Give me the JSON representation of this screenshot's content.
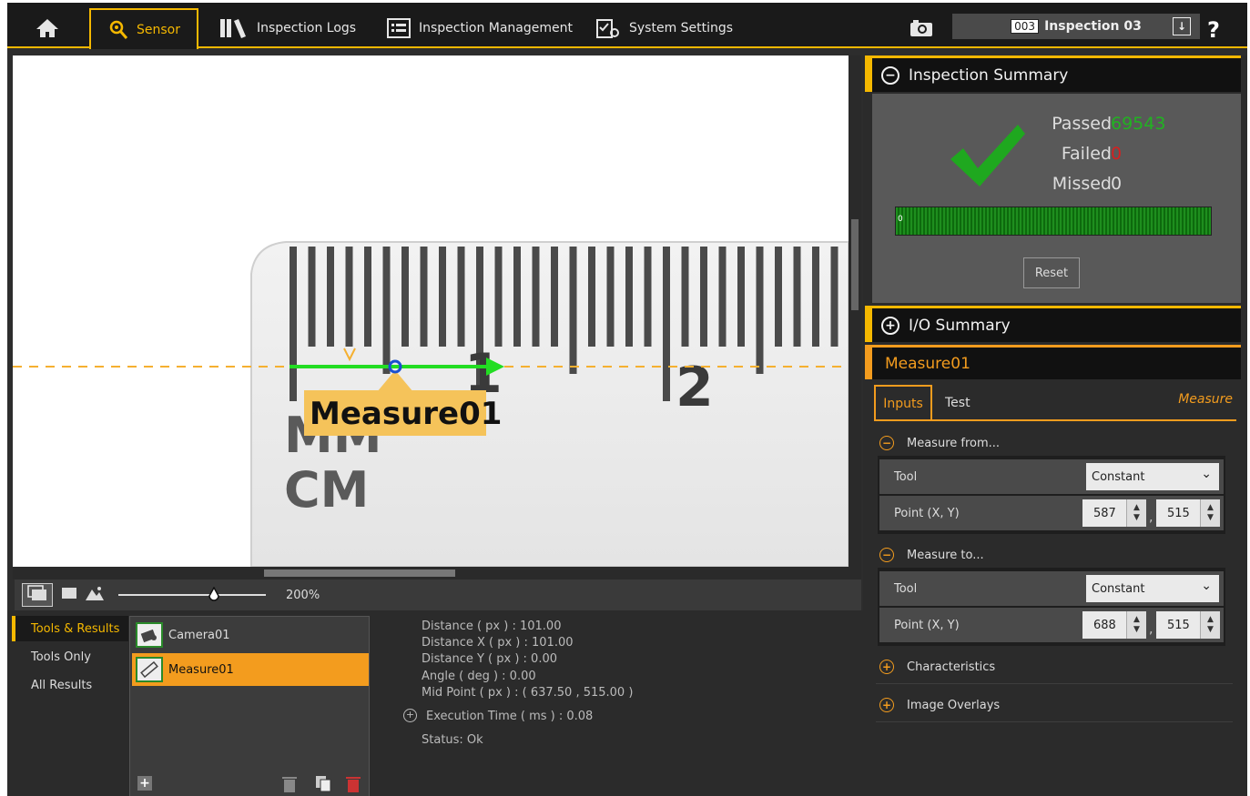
{
  "topbar": {
    "tabs": [
      {
        "label": "Sensor"
      },
      {
        "label": "Inspection Logs"
      },
      {
        "label": "Inspection Management"
      },
      {
        "label": "System Settings"
      }
    ],
    "inspection_code": "003",
    "inspection_name": "Inspection 03",
    "help": "?"
  },
  "viewer": {
    "overlay_label": "Measure01",
    "ruler_numbers": [
      "1",
      "2"
    ],
    "ruler_units": [
      "MM",
      "CM"
    ],
    "zoom": "200%"
  },
  "filters": [
    "Tools & Results",
    "Tools Only",
    "All Results"
  ],
  "tools": [
    {
      "name": "Camera01"
    },
    {
      "name": "Measure01"
    }
  ],
  "results": {
    "distance": "Distance ( px ) :  101.00",
    "distance_x": "Distance X ( px ) :  101.00",
    "distance_y": "Distance Y ( px ) :  0.00",
    "angle": "Angle ( deg ) :  0.00",
    "mid_point": "Mid Point ( px ) :  ( 637.50 , 515.00 )",
    "exec_time": "Execution Time ( ms ) : 0.08",
    "status": "Status: Ok"
  },
  "summary": {
    "title": "Inspection Summary",
    "passed_label": "Passed",
    "passed_value": "69543",
    "failed_label": "Failed",
    "failed_value": "0",
    "missed_label": "Missed",
    "missed_value": "0",
    "bar_marker": "0",
    "reset_label": "Reset",
    "pass_color": "#21b321",
    "fail_color": "#d62020"
  },
  "io_summary": {
    "title": "I/O Summary"
  },
  "tool_panel": {
    "title": "Measure01",
    "tab_inputs": "Inputs",
    "tab_test": "Test",
    "tool_type": "Measure",
    "measure_from": {
      "title": "Measure from...",
      "tool_label": "Tool",
      "tool_value": "Constant",
      "point_label": "Point (X, Y)",
      "x": "587",
      "y": "515"
    },
    "measure_to": {
      "title": "Measure to...",
      "tool_label": "Tool",
      "tool_value": "Constant",
      "point_label": "Point (X, Y)",
      "x": "688",
      "y": "515"
    },
    "characteristics": "Characteristics",
    "image_overlays": "Image Overlays"
  }
}
